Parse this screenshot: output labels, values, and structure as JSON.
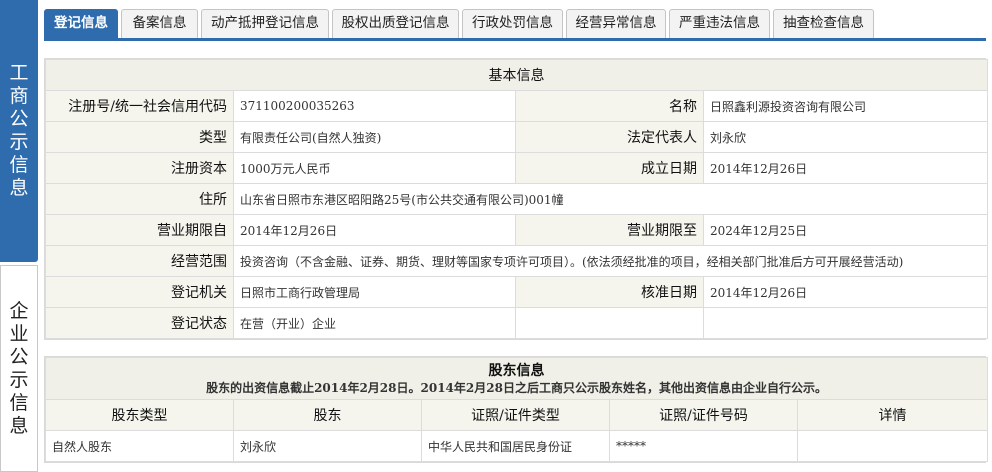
{
  "left_tabs": {
    "active": "工商公示信息",
    "inactive": "企业公示信息"
  },
  "tabs": [
    "登记信息",
    "备案信息",
    "动产抵押登记信息",
    "股权出质登记信息",
    "行政处罚信息",
    "经营异常信息",
    "严重违法信息",
    "抽查检查信息"
  ],
  "active_tab_index": 0,
  "basic": {
    "title": "基本信息",
    "reg_no_label": "注册号/统一社会信用代码",
    "reg_no": "371100200035263",
    "name_label": "名称",
    "name": "日照鑫利源投资咨询有限公司",
    "type_label": "类型",
    "type": "有限责任公司(自然人独资)",
    "legal_rep_label": "法定代表人",
    "legal_rep": "刘永欣",
    "capital_label": "注册资本",
    "capital": "1000万元人民币",
    "est_date_label": "成立日期",
    "est_date": "2014年12月26日",
    "address_label": "住所",
    "address": "山东省日照市东港区昭阳路25号(市公共交通有限公司)001幢",
    "period_from_label": "营业期限自",
    "period_from": "2014年12月26日",
    "period_to_label": "营业期限至",
    "period_to": "2024年12月25日",
    "scope_label": "经营范围",
    "scope": "投资咨询（不含金融、证券、期货、理财等国家专项许可项目）。(依法须经批准的项目，经相关部门批准后方可开展经营活动)",
    "authority_label": "登记机关",
    "authority": "日照市工商行政管理局",
    "approve_date_label": "核准日期",
    "approve_date": "2014年12月26日",
    "status_label": "登记状态",
    "status": "在营（开业）企业"
  },
  "shareholders": {
    "title": "股东信息",
    "note": "股东的出资信息截止2014年2月28日。2014年2月28日之后工商只公示股东姓名，其他出资信息由企业自行公示。",
    "columns": [
      "股东类型",
      "股东",
      "证照/证件类型",
      "证照/证件号码",
      "详情"
    ],
    "rows": [
      [
        "自然人股东",
        "刘永欣",
        "中华人民共和国居民身份证",
        "*****",
        ""
      ]
    ]
  }
}
